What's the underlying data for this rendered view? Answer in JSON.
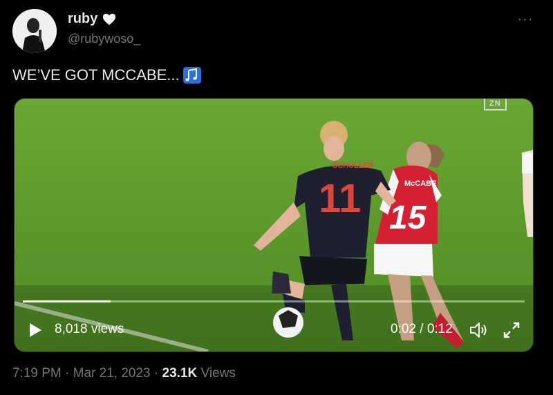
{
  "author": {
    "display_name": "ruby",
    "handle": "@rubywoso_"
  },
  "tweet": {
    "text": "WE’VE GOT MCCABE..."
  },
  "video": {
    "broadcaster": "ZN",
    "players": {
      "left_name": "SCHÜLLER",
      "left_number": "11",
      "right_name": "McCABE",
      "right_number": "15"
    },
    "progress": 0.175,
    "views": "8,018 views",
    "time": "0:02 / 0:12"
  },
  "footer": {
    "time": "7:19 PM",
    "sep1": " · ",
    "date": "Mar 21, 2023",
    "sep2": " · ",
    "view_count": "23.1K",
    "views_label": " Views"
  },
  "colors": {
    "background": "#000000",
    "pitch": "#5e9a2c",
    "text_secondary": "#71767b"
  }
}
